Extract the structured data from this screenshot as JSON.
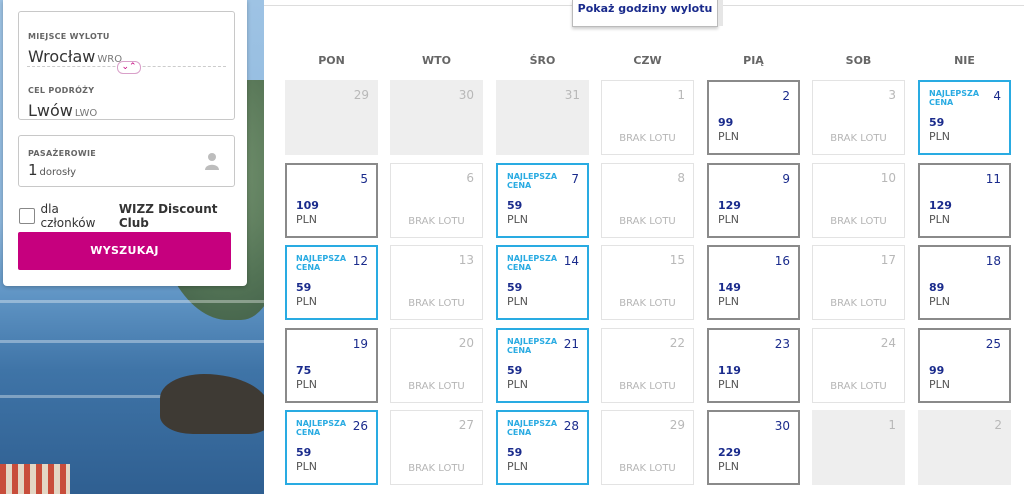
{
  "search": {
    "from_label": "MIEJSCE WYLOTU",
    "from_city": "Wrocław",
    "from_code": "WRO",
    "to_label": "CEL PODRÓŻY",
    "to_city": "Lwów",
    "to_code": "LWO",
    "swap_symbol": "⌄⌃",
    "pax_label": "PASAŻEROWIE",
    "pax_count": "1",
    "pax_unit": "dorosły",
    "club_prefix": "dla członków",
    "club_name": "WIZZ Discount Club",
    "button": "WYSZUKAJ"
  },
  "calendar": {
    "show_hours": "Pokaż godziny wylotu",
    "weekdays": [
      "PON",
      "WTO",
      "ŚRO",
      "CZW",
      "PIĄ",
      "SOB",
      "NIE"
    ],
    "best_label_1": "NAJLEPSZA",
    "best_label_2": "CENA",
    "no_flight": "BRAK LOTU",
    "currency": "PLN",
    "weeks": [
      [
        {
          "day": "29",
          "state": "past"
        },
        {
          "day": "30",
          "state": "past"
        },
        {
          "day": "31",
          "state": "past"
        },
        {
          "day": "1",
          "state": "none"
        },
        {
          "day": "2",
          "state": "flight",
          "price": "99"
        },
        {
          "day": "3",
          "state": "none"
        },
        {
          "day": "4",
          "state": "best",
          "price": "59"
        }
      ],
      [
        {
          "day": "5",
          "state": "flight",
          "price": "109"
        },
        {
          "day": "6",
          "state": "none"
        },
        {
          "day": "7",
          "state": "best",
          "price": "59"
        },
        {
          "day": "8",
          "state": "none"
        },
        {
          "day": "9",
          "state": "flight",
          "price": "129"
        },
        {
          "day": "10",
          "state": "none"
        },
        {
          "day": "11",
          "state": "flight",
          "price": "129"
        }
      ],
      [
        {
          "day": "12",
          "state": "best",
          "price": "59"
        },
        {
          "day": "13",
          "state": "none"
        },
        {
          "day": "14",
          "state": "best",
          "price": "59"
        },
        {
          "day": "15",
          "state": "none"
        },
        {
          "day": "16",
          "state": "flight",
          "price": "149"
        },
        {
          "day": "17",
          "state": "none"
        },
        {
          "day": "18",
          "state": "flight",
          "price": "89"
        }
      ],
      [
        {
          "day": "19",
          "state": "flight",
          "price": "75"
        },
        {
          "day": "20",
          "state": "none"
        },
        {
          "day": "21",
          "state": "best",
          "price": "59"
        },
        {
          "day": "22",
          "state": "none"
        },
        {
          "day": "23",
          "state": "flight",
          "price": "119"
        },
        {
          "day": "24",
          "state": "none"
        },
        {
          "day": "25",
          "state": "flight",
          "price": "99"
        }
      ],
      [
        {
          "day": "26",
          "state": "best",
          "price": "59"
        },
        {
          "day": "27",
          "state": "none"
        },
        {
          "day": "28",
          "state": "best",
          "price": "59"
        },
        {
          "day": "29",
          "state": "none"
        },
        {
          "day": "30",
          "state": "flight",
          "price": "229"
        },
        {
          "day": "1",
          "state": "past"
        },
        {
          "day": "2",
          "state": "past"
        }
      ]
    ]
  },
  "colors": {
    "brand_magenta": "#c6007e",
    "best_price_blue": "#29abe2",
    "price_navy": "#1a2b8c"
  }
}
